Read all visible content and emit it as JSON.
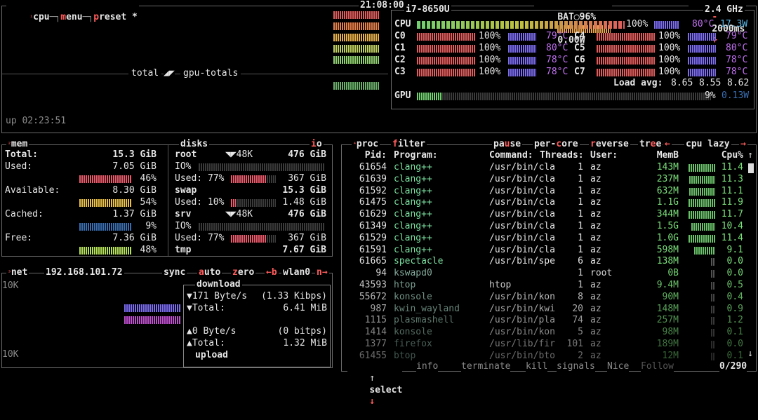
{
  "topbar": {
    "cpu": "cpu",
    "menu": "menu",
    "preset": "preset *",
    "clock": "21:08:00",
    "battery": "BAT",
    "battery_pct": "96%",
    "power": "0.00W",
    "minus": "-",
    "interval": "2000ms",
    "plus": "+"
  },
  "cpu": {
    "model": "i7-8650U",
    "freq": "2.4 GHz",
    "total_label": "CPU",
    "total_pct": "100%",
    "total_temp": "80°C",
    "total_temp2": "17.3W",
    "cores_left": [
      {
        "label": "C0",
        "pct": "100%",
        "temp": "79°C"
      },
      {
        "label": "C1",
        "pct": "100%",
        "temp": "80°C"
      },
      {
        "label": "C2",
        "pct": "100%",
        "temp": "78°C"
      },
      {
        "label": "C3",
        "pct": "100%",
        "temp": "78°C"
      }
    ],
    "cores_right": [
      {
        "label": "C4",
        "pct": "100%",
        "temp": "79°C"
      },
      {
        "label": "C5",
        "pct": "100%",
        "temp": "80°C"
      },
      {
        "label": "C6",
        "pct": "100%",
        "temp": "78°C"
      },
      {
        "label": "C7",
        "pct": "100%",
        "temp": "78°C"
      }
    ],
    "load_label": "Load avg:",
    "load": [
      "8.65",
      "8.55",
      "8.62"
    ],
    "gpu_label": "GPU",
    "gpu_pct": "9%",
    "gpu_temp": "0.13W",
    "graph_label_total": "total",
    "graph_label_gpu": "gpu-totals",
    "uptime": "up 02:23:51"
  },
  "mem": {
    "title": "mem",
    "total_label": "Total:",
    "total": "15.3 GiB",
    "used_label": "Used:",
    "used": "7.05 GiB",
    "used_pct": 46,
    "available_label": "Available:",
    "available": "8.30 GiB",
    "available_pct": 54,
    "cached_label": "Cached:",
    "cached": "1.37 GiB",
    "cached_pct": 9,
    "free_label": "Free:",
    "free": "7.36 GiB",
    "free_pct": 48,
    "pct_suffix": "%"
  },
  "disks": {
    "title": "disks",
    "io": "io",
    "io_label": "IO%",
    "used_label": "Used:",
    "items": [
      {
        "name": "root",
        "io": "48K",
        "size": "476 GiB",
        "used_pct": "77%",
        "used_pct_num": 77,
        "used": "367 GiB"
      },
      {
        "name": "swap",
        "size": "15.3 GiB",
        "used_pct": "10%",
        "used_pct_num": 10,
        "used": "1.48 GiB"
      },
      {
        "name": "srv",
        "io": "48K",
        "size": "476 GiB",
        "used_pct": "77%",
        "used_pct_num": 77,
        "used": "367 GiB"
      },
      {
        "name": "tmp",
        "size": "7.67 GiB"
      }
    ]
  },
  "net": {
    "title": "net",
    "ip": "192.168.101.72",
    "sync": "sync",
    "auto": "auto",
    "zero": "zero",
    "prev": "←b",
    "iface": "wlan0",
    "next": "n→",
    "scale_top": "10K",
    "scale_bottom": "10K",
    "download": "download",
    "dl_rate": "171 Byte/s",
    "dl_bits": "(1.33 Kibps)",
    "dl_total_label": "Total:",
    "dl_total": "6.41 MiB",
    "ul_rate": "0 Byte/s",
    "ul_bits": "(0 bitps)",
    "ul_total_label": "Total:",
    "ul_total": "1.32 MiB",
    "upload": "upload"
  },
  "proc": {
    "title": "proc",
    "filter": "filter",
    "pause": "pause",
    "per_core": "per-core",
    "reverse": "reverse",
    "tree": "tree",
    "arrow_left": "←",
    "sort": "cpu lazy",
    "arrow_right": "→",
    "headers": {
      "pid": "Pid:",
      "program": "Program:",
      "command": "Command:",
      "threads": "Threads:",
      "user": "User:",
      "memb": "MemB",
      "cpu": "Cpu%"
    },
    "rows": [
      {
        "pid": "61654",
        "program": "clang++",
        "command": "/usr/bin/cla",
        "threads": "1",
        "user": "az",
        "mem": "143M",
        "cpu": "11.4"
      },
      {
        "pid": "61639",
        "program": "clang++",
        "command": "/usr/bin/cla",
        "threads": "1",
        "user": "az",
        "mem": "237M",
        "cpu": "11.3"
      },
      {
        "pid": "61592",
        "program": "clang++",
        "command": "/usr/bin/cla",
        "threads": "1",
        "user": "az",
        "mem": "632M",
        "cpu": "11.1"
      },
      {
        "pid": "61475",
        "program": "clang++",
        "command": "/usr/bin/cla",
        "threads": "1",
        "user": "az",
        "mem": "1.1G",
        "cpu": "11.9"
      },
      {
        "pid": "61629",
        "program": "clang++",
        "command": "/usr/bin/cla",
        "threads": "1",
        "user": "az",
        "mem": "344M",
        "cpu": "11.7"
      },
      {
        "pid": "61349",
        "program": "clang++",
        "command": "/usr/bin/cla",
        "threads": "1",
        "user": "az",
        "mem": "1.5G",
        "cpu": "10.4"
      },
      {
        "pid": "61529",
        "program": "clang++",
        "command": "/usr/bin/cla",
        "threads": "1",
        "user": "az",
        "mem": "1.0G",
        "cpu": "11.4"
      },
      {
        "pid": "61591",
        "program": "clang++",
        "command": "/usr/bin/cla",
        "threads": "1",
        "user": "az",
        "mem": "598M",
        "cpu": "9.1"
      },
      {
        "pid": "61665",
        "program": "spectacle",
        "command": "/usr/bin/spe",
        "threads": "6",
        "user": "az",
        "mem": "138M",
        "cpu": "0.0"
      },
      {
        "pid": "94",
        "program": "kswapd0",
        "command": "",
        "threads": "1",
        "user": "root",
        "mem": "0B",
        "cpu": "0.0"
      },
      {
        "pid": "43593",
        "program": "htop",
        "command": "htop",
        "threads": "1",
        "user": "az",
        "mem": "9.4M",
        "cpu": "0.5"
      },
      {
        "pid": "55672",
        "program": "konsole",
        "command": "/usr/bin/kon",
        "threads": "8",
        "user": "az",
        "mem": "90M",
        "cpu": "0.4"
      },
      {
        "pid": "987",
        "program": "kwin_wayland",
        "command": "/usr/bin/kwi",
        "threads": "20",
        "user": "az",
        "mem": "148M",
        "cpu": "0.9"
      },
      {
        "pid": "1115",
        "program": "plasmashell",
        "command": "/usr/bin/pla",
        "threads": "74",
        "user": "az",
        "mem": "257M",
        "cpu": "1.2"
      },
      {
        "pid": "1414",
        "program": "konsole",
        "command": "/usr/bin/kon",
        "threads": "5",
        "user": "az",
        "mem": "98M",
        "cpu": "0.1"
      },
      {
        "pid": "1377",
        "program": "firefox",
        "command": "/usr/lib/fir",
        "threads": "101",
        "user": "az",
        "mem": "189M",
        "cpu": "0.0"
      },
      {
        "pid": "61455",
        "program": "btop",
        "command": "/usr/bin/bto",
        "threads": "2",
        "user": "az",
        "mem": "12M",
        "cpu": "0.1"
      }
    ],
    "footer": {
      "up": "↑",
      "select": "select",
      "down": "↓",
      "info": "info",
      "terminate": "terminate",
      "kill": "kill",
      "signals": "signals",
      "nice": "Nice",
      "follow": "Follow",
      "count": "0/290"
    }
  },
  "colors": {
    "accent": "#ff5c5c",
    "border": "#6a6a6a",
    "cpu_bar": "#e05c5c",
    "temp_bar": "#7b6cf0",
    "green": "#7be07b",
    "mem_used": "#e85a6a",
    "mem_avail": "#e8c04a",
    "mem_cached": "#3a6db0",
    "mem_free": "#b4e05a"
  }
}
